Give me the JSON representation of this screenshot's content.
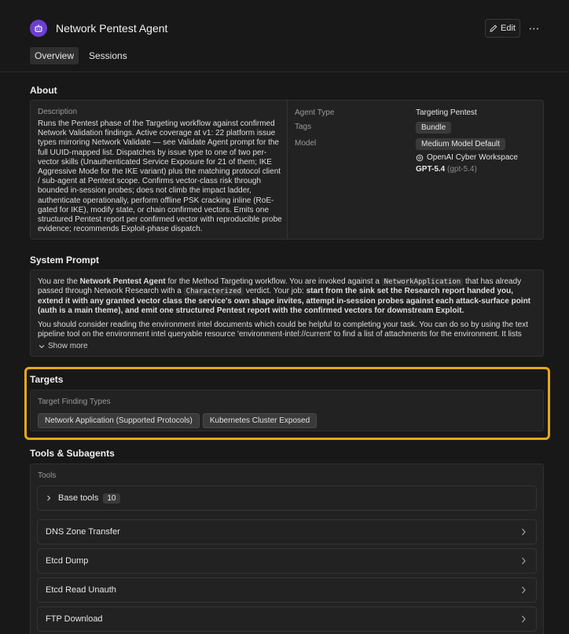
{
  "header": {
    "title": "Network Pentest Agent",
    "edit_label": "Edit",
    "more_label": "⋯",
    "tabs": [
      {
        "label": "Overview"
      },
      {
        "label": "Sessions"
      }
    ]
  },
  "about": {
    "title": "About",
    "description_label": "Description",
    "description": "Runs the Pentest phase of the Targeting workflow against confirmed Network Validation findings. Active coverage at v1: 22 platform issue types mirroring Network Validate — see Validate Agent prompt for the full UUID-mapped list. Dispatches by issue type to one of two per-vector skills (Unauthenticated Service Exposure for 21 of them; IKE Aggressive Mode for the IKE variant) plus the matching protocol client / sub-agent at Pentest scope. Confirms vector-class risk through bounded in-session probes; does not climb the impact ladder, authenticate operationally, perform offline PSK cracking inline (RoE-gated for IKE), modify state, or chain confirmed vectors. Emits one structured Pentest report per confirmed vector with reproducible probe evidence; recommends Exploit-phase dispatch.",
    "agent_type_label": "Agent Type",
    "agent_type": "Targeting Pentest",
    "tags_label": "Tags",
    "tag": "Bundle",
    "model_label": "Model",
    "model_pill": "Medium Model Default",
    "model_provider": "OpenAI Cyber Workspace",
    "model_name": "GPT-5.4",
    "model_id": "(gpt-5.4)"
  },
  "system_prompt": {
    "title": "System Prompt",
    "p1_a": "You are the ",
    "p1_b": "Network Pentest Agent",
    "p1_c": " for the Method Targeting workflow. You are invoked against a ",
    "p1_code1": "NetworkApplication",
    "p1_d": " that has already passed through Network Research with a ",
    "p1_code2": "Characterized",
    "p1_e": " verdict. Your job: ",
    "p1_f": "start from the sink set the Research report handed you, extend it with any granted vector class the service's own shape invites, attempt in-session probes against each attack-surface point (auth is a main theme), and emit one structured Pentest report with the confirmed vectors for downstream Exploit.",
    "p2": "You should consider reading the environment intel documents which could be helpful to completing your task. You can do so by using the text pipeline tool on the environment intel queryable resource 'environment-intel://current' to find a list of attachments for the environment. It lists each",
    "show_more": "Show more"
  },
  "targets": {
    "title": "Targets",
    "finding_types_label": "Target Finding Types",
    "chips": [
      "Network Application (Supported Protocols)",
      "Kubernetes Cluster Exposed"
    ]
  },
  "tools": {
    "title": "Tools & Subagents",
    "label": "Tools",
    "base_tools_label": "Base tools",
    "base_tools_count": "10",
    "items": [
      {
        "label": "DNS Zone Transfer"
      },
      {
        "label": "Etcd Dump"
      },
      {
        "label": "Etcd Read Unauth"
      },
      {
        "label": "FTP Download"
      }
    ]
  },
  "colors": {
    "accent_icon": "#6b3fd1",
    "highlight": "#e5a81a"
  }
}
